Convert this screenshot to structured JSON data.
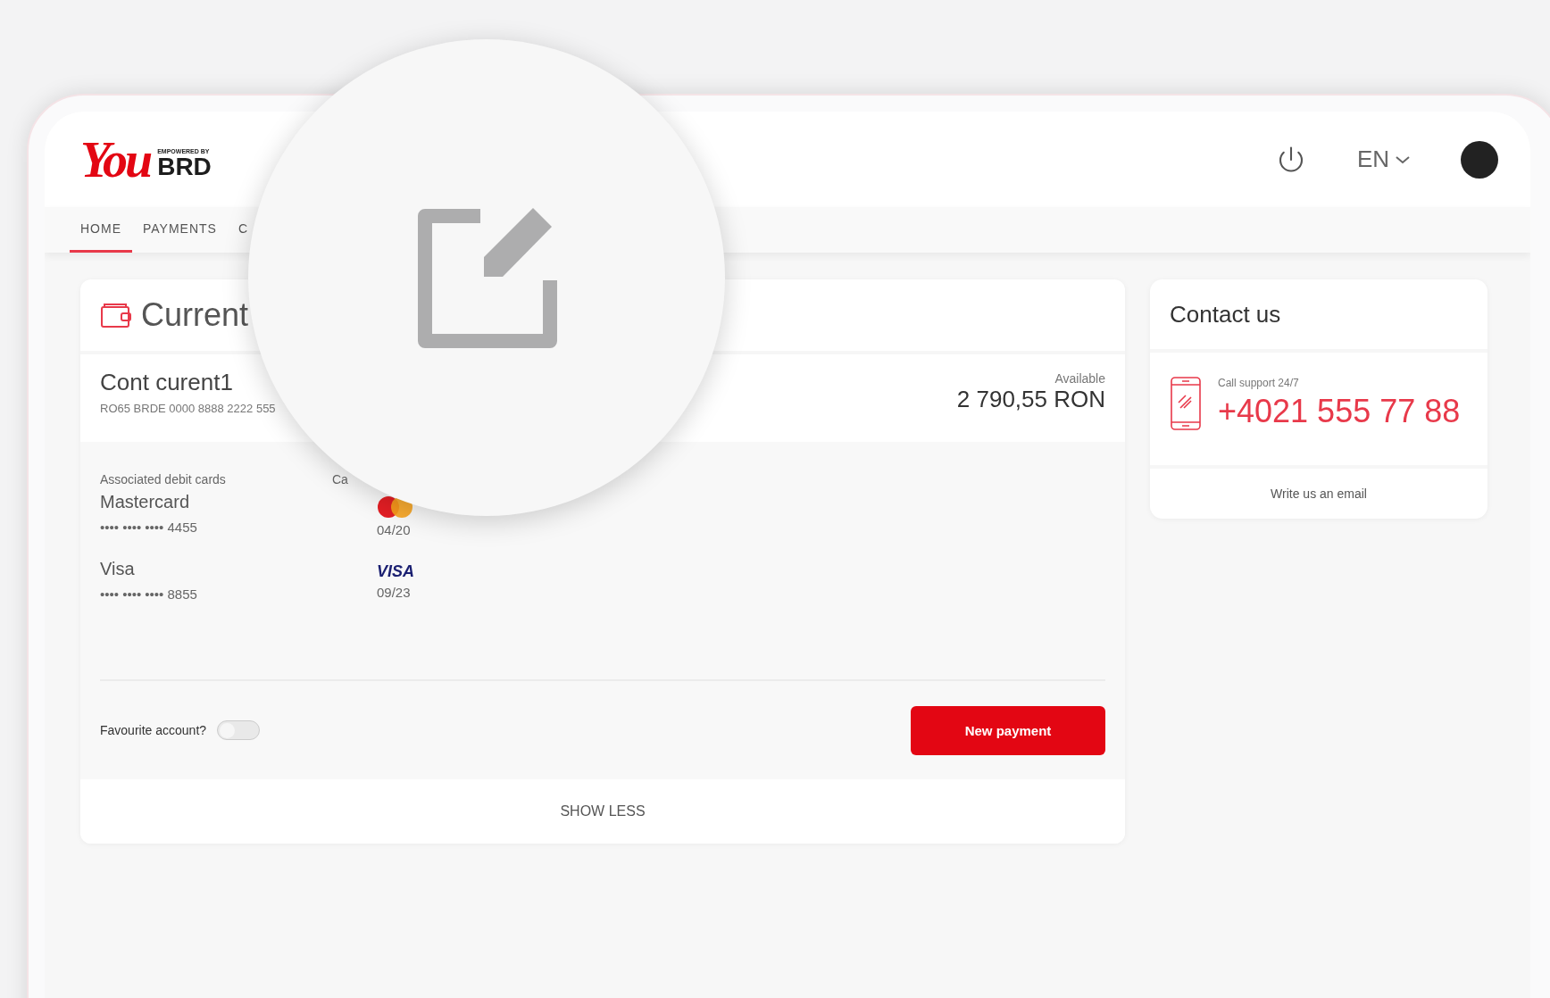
{
  "logo": {
    "word": "You",
    "tagline": "EMPOWERED BY",
    "brand": "BRD"
  },
  "header": {
    "language": "EN"
  },
  "nav": [
    {
      "label": "HOME",
      "selected": true
    },
    {
      "label": "PAYMENTS",
      "selected": false
    },
    {
      "label": "C",
      "selected": false
    }
  ],
  "account_panel": {
    "title": "Current",
    "account": {
      "name": "Cont curent1",
      "iban": "RO65 BRDE 0000 8888 2222 555",
      "balance_label": "Available",
      "balance": "2 790,55 RON"
    },
    "cards_heading": "Associated debit cards",
    "column_2_heading": "Ca",
    "cards": [
      {
        "kind": "mastercard",
        "name": "Mastercard",
        "number": "•••• •••• •••• 4455",
        "expiry": "04/20"
      },
      {
        "kind": "visa",
        "name": "Visa",
        "number": "•••• •••• ••••  8855",
        "expiry": "09/23",
        "logo_text": "VISA"
      }
    ],
    "favourite": {
      "label": "Favourite account?",
      "on": false
    },
    "new_payment": "New payment",
    "show_less": "SHOW LESS"
  },
  "contact": {
    "title": "Contact us",
    "support_label": "Call support 24/7",
    "phone": "+4021 555 77 88",
    "email_link": "Write us an email"
  }
}
